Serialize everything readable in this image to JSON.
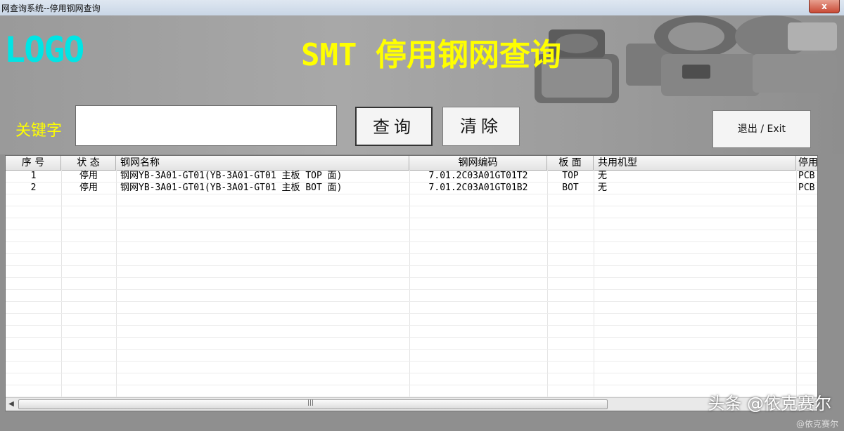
{
  "window": {
    "title": "网查询系统--停用钢网查询",
    "close_label": "x"
  },
  "header": {
    "logo": "LOGO",
    "title": "SMT 停用钢网查询"
  },
  "search": {
    "label": "关键字",
    "value": "",
    "placeholder": ""
  },
  "buttons": {
    "query": "查询",
    "clear": "清除",
    "exit": "退出 / Exit"
  },
  "table": {
    "columns": [
      "序 号",
      "状 态",
      "钢网名称",
      "钢网编码",
      "板 面",
      "共用机型",
      "停用"
    ],
    "rows": [
      [
        "1",
        "停用",
        "钢网YB-3A01-GT01(YB-3A01-GT01 主板 TOP 面)",
        "7.01.2C03A01GT01T2",
        "TOP",
        "无",
        "PCB"
      ],
      [
        "2",
        "停用",
        "钢网YB-3A01-GT01(YB-3A01-GT01 主板 BOT 面)",
        "7.01.2C03A01GT01B2",
        "BOT",
        "无",
        "PCB"
      ]
    ]
  },
  "watermark": {
    "main": "头条 @依克赛尔",
    "small": "@依克赛尔"
  },
  "colors": {
    "logo": "#00e5e5",
    "title": "#ffff00",
    "label": "#ffff00"
  }
}
